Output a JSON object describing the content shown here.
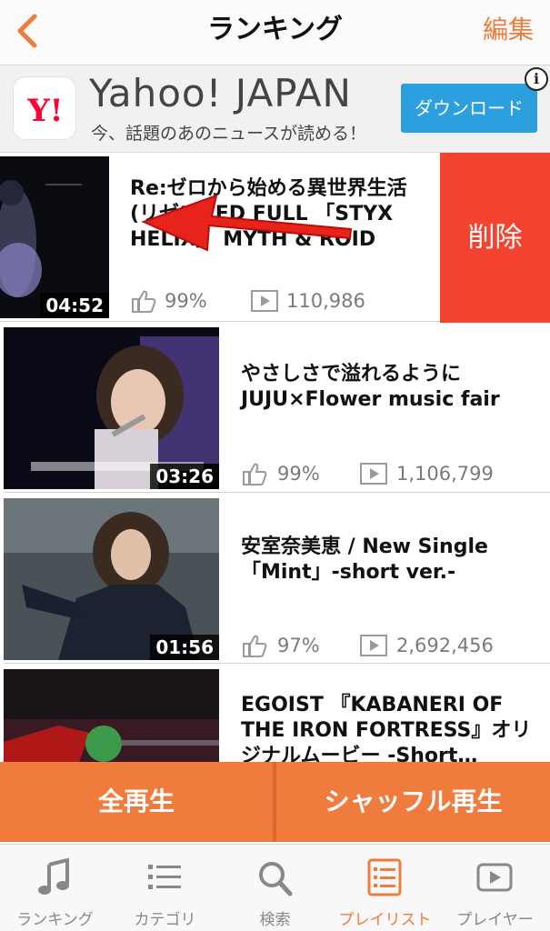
{
  "header": {
    "title": "ランキング",
    "edit_label": "編集",
    "back_icon": "chevron-left-icon"
  },
  "ad": {
    "logo_text": "Y!",
    "title": "Yahoo! JAPAN",
    "subtitle": "今、話題のあのニュースが読める！",
    "button_label": "ダウンロード",
    "info_label": "i"
  },
  "videos": [
    {
      "title": "Re:ゼロから始める異世界生活(リゼロ) ED FULL 「STYX HELIX」 MYTH & ROID",
      "duration": "04:52",
      "rating": "99%",
      "views": "110,986"
    },
    {
      "title": "やさしさで溢れるように JUJU×Flower music fair",
      "duration": "03:26",
      "rating": "99%",
      "views": "1,106,799"
    },
    {
      "title": "安室奈美恵 / New Single「Mint」-short ver.-",
      "duration": "01:56",
      "rating": "97%",
      "views": "2,692,456"
    },
    {
      "title": "EGOIST 『KABANERI OF THE IRON FORTRESS』オリジナルムービー -Short…",
      "duration": "",
      "rating": "",
      "views": ""
    }
  ],
  "delete_label": "削除",
  "actions": {
    "play_all": "全再生",
    "shuffle": "シャッフル再生"
  },
  "tabs": [
    {
      "label": "ランキング",
      "icon": "music-note-icon",
      "active": false
    },
    {
      "label": "カテゴリ",
      "icon": "list-icon",
      "active": false
    },
    {
      "label": "検索",
      "icon": "search-icon",
      "active": false
    },
    {
      "label": "プレイリスト",
      "icon": "playlist-icon",
      "active": true
    },
    {
      "label": "プレイヤー",
      "icon": "player-icon",
      "active": false
    }
  ],
  "colors": {
    "accent": "#ef7b3c",
    "delete": "#f4432f",
    "ad_button": "#2ca0de"
  }
}
